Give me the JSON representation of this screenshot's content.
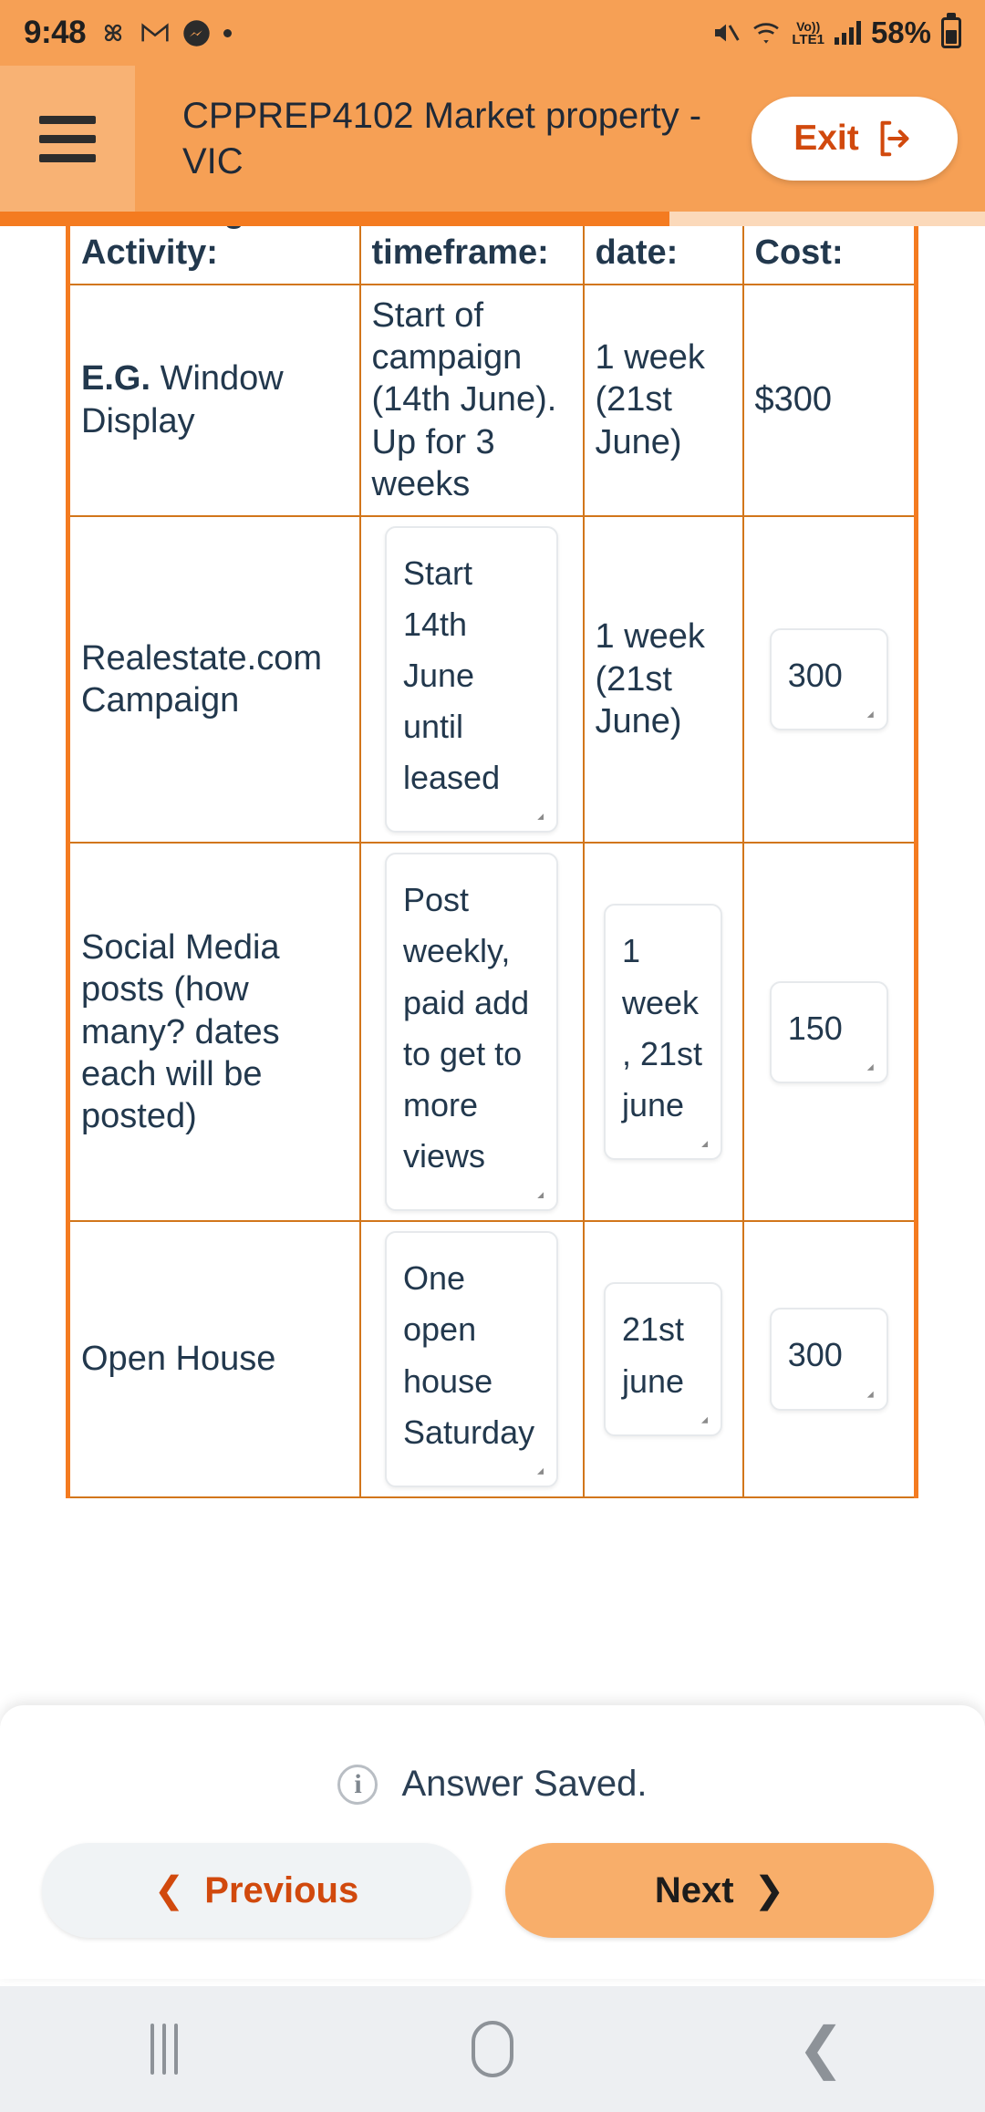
{
  "status_bar": {
    "time": "9:48",
    "left_icons": [
      "pinwheel-icon",
      "gmail-icon",
      "messenger-icon",
      "dot-icon"
    ],
    "right_icons": [
      "mute-icon",
      "wifi-icon",
      "volte-icon",
      "signal-icon"
    ],
    "volte_top": "Vo))",
    "volte_bottom": "LTE1",
    "battery_percent": "58%"
  },
  "header": {
    "menu_icon": "hamburger-icon",
    "title": "CPPREP4102 Market property - VIC",
    "exit_label": "Exit",
    "exit_icon": "logout-icon"
  },
  "progress": {
    "percent": 68
  },
  "table": {
    "headers": [
      "Marketing Activity:",
      "Date and timeframe:",
      "Review date:",
      "Cost:"
    ],
    "rows": [
      {
        "activity_bold": "E.G.",
        "activity": " Window Display",
        "timeframe": "Start of campaign (14th June). Up for 3 weeks",
        "review": "1 week (21st June)",
        "cost": "$300",
        "editable": false
      },
      {
        "activity": "Realestate.com Campaign",
        "timeframe": "Start 14th June until leased",
        "review": "1 week (21st June)",
        "cost": "300",
        "editable": true,
        "review_editable": false
      },
      {
        "activity": "Social Media posts (how many? dates each will be posted)",
        "timeframe": "Post weekly, paid add to get to more views",
        "review": "1 week, 21st june",
        "cost": "150",
        "editable": true,
        "review_editable": true
      },
      {
        "activity": "Open House",
        "timeframe": "One open house Saturday",
        "review": "21st june",
        "cost": "300",
        "editable": true,
        "review_editable": true
      }
    ]
  },
  "footer": {
    "info_icon": "info-icon",
    "saved_message": "Answer Saved.",
    "previous_label": "Previous",
    "previous_icon": "chevron-left-icon",
    "next_label": "Next",
    "next_icon": "chevron-right-icon"
  },
  "android_nav": {
    "recents_icon": "recents-icon",
    "home_icon": "home-icon",
    "back_icon": "back-icon"
  },
  "colors": {
    "header_orange": "#F6A055",
    "progress_orange": "#F47B20",
    "accent_red": "#D1490D",
    "table_border": "#D2761B",
    "text_dark": "#22384d"
  }
}
